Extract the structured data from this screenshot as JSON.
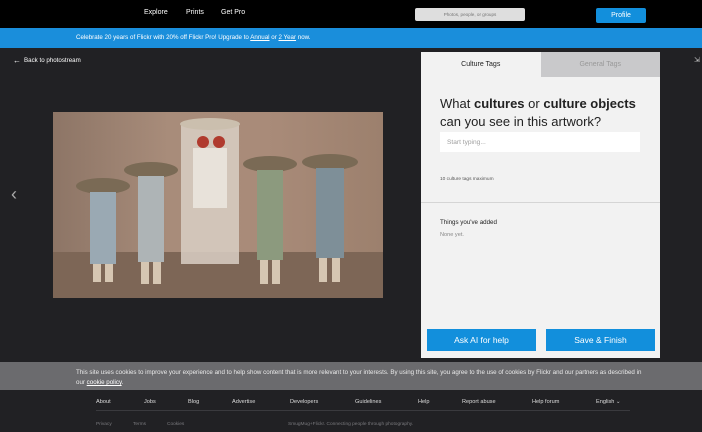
{
  "nav": {
    "links": [
      "Explore",
      "Prints",
      "Get Pro"
    ],
    "search_placeholder": "Photos, people, or groups",
    "profile_label": "Profile"
  },
  "banner": {
    "text_before": "Celebrate 20 years of Flickr with 20% off Flickr Pro! Upgrade to ",
    "annual_link": "Annual",
    "or_text": " or ",
    "two_year_link": "2 Year",
    "text_after": " now."
  },
  "viewer": {
    "back_label": "Back to photostream"
  },
  "tags_panel": {
    "tabs": [
      "Culture Tags",
      "General Tags"
    ],
    "question": {
      "part1": "What ",
      "bold1": "cultures",
      "part2": " or ",
      "bold2": "culture objects",
      "part3": " can you see in this artwork?"
    },
    "input_placeholder": "Start typing...",
    "max_note": "10 culture tags maximum",
    "added_title": "Things you've added",
    "added_empty": "None yet.",
    "ai_button": "Ask AI for help",
    "save_button": "Save & Finish"
  },
  "cookie": {
    "text": "This site uses cookies to improve your experience and to help show content that is more relevant to your interests. By using this site, you agree to the use of cookies by Flickr and our partners as described in our ",
    "link": "cookie policy",
    "end": "."
  },
  "footer": {
    "links": [
      "About",
      "Jobs",
      "Blog",
      "Advertise",
      "Developers",
      "Guidelines",
      "Help",
      "Report abuse",
      "Help forum",
      "English"
    ],
    "sub_links": [
      "Privacy",
      "Terms",
      "Cookies"
    ],
    "tagline": "SmugMug+Flickr. Connecting people through photography."
  },
  "colors": {
    "accent": "#128fdc",
    "banner": "#1a8edb",
    "background": "#212124"
  }
}
